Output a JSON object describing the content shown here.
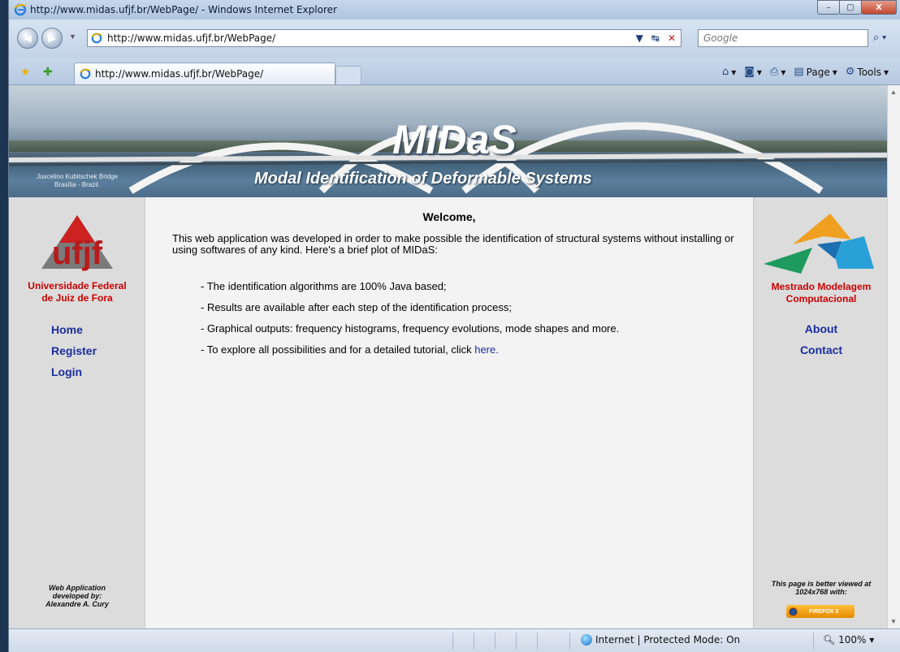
{
  "window": {
    "title": "http://www.midas.ufjf.br/WebPage/ - Windows Internet Explorer",
    "controls": {
      "minimize": "–",
      "maximize": "▢",
      "close": "X"
    }
  },
  "browser": {
    "address": "http://www.midas.ufjf.br/WebPage/",
    "search_placeholder": "Google",
    "tab_title": "http://www.midas.ufjf.br/WebPage/",
    "commands": {
      "page": "Page",
      "tools": "Tools"
    },
    "status_zone": "Internet | Protected Mode: On",
    "zoom": "100%"
  },
  "banner": {
    "title": "MIDaS",
    "subtitle": "Modal Identification of Deformable Systems",
    "caption_line1": "Juscelino Kubitschek Bridge",
    "caption_line2": "Brasília - Brazil."
  },
  "left": {
    "logo_text": "ufjf",
    "org_line1": "Universidade Federal",
    "org_line2": "de Juiz de Fora",
    "nav": [
      "Home",
      "Register",
      "Login"
    ],
    "credit_line1": "Web Application",
    "credit_line2": "developed by:",
    "credit_line3": "Alexandre A. Cury"
  },
  "main": {
    "welcome": "Welcome,",
    "intro": "This web application was developed in order to make possible the identification of structural systems without installing or using softwares of any kind. Here's a brief plot of MIDaS:",
    "bullets": [
      "- The identification algorithms are 100% Java based;",
      "- Results are available after each step of the identification process;",
      "- Graphical outputs: frequency histograms, frequency evolutions, mode shapes and more."
    ],
    "last_bullet_prefix": "- To explore all possibilities and for a detailed tutorial, click ",
    "last_bullet_link": "here."
  },
  "right": {
    "org_line1": "Mestrado Modelagem",
    "org_line2": "Computacional",
    "nav": [
      "About",
      "Contact"
    ],
    "better_line1": "This page is better viewed at",
    "better_line2": "1024x768 with:",
    "badge": "FIREFOX 3"
  },
  "colors": {
    "link": "#1a2e9e",
    "org_red": "#cc0000",
    "sidebar_bg": "#dcdcdc",
    "content_bg": "#f3f3f3"
  }
}
